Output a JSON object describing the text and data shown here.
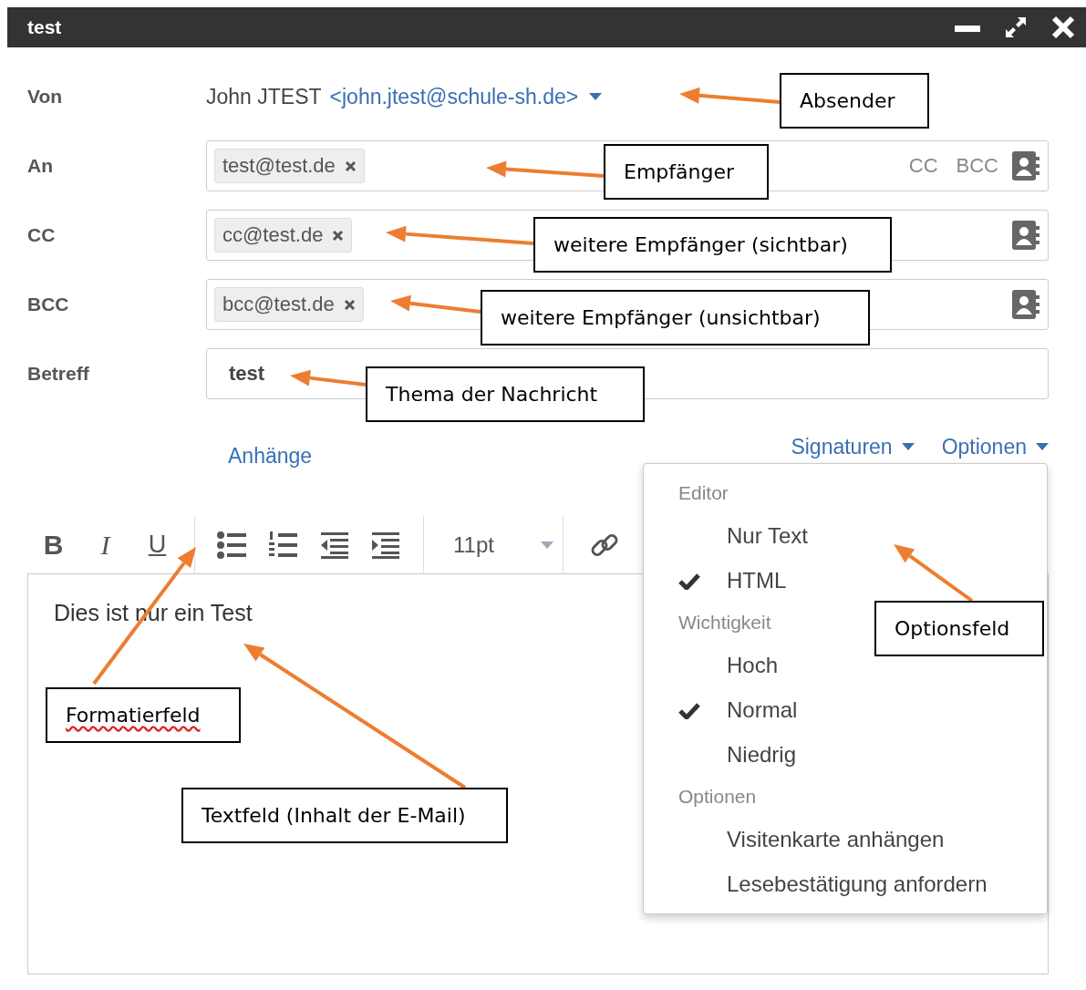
{
  "window": {
    "title": "test"
  },
  "from": {
    "label": "Von",
    "name": "John JTEST",
    "address": "<john.jtest@schule-sh.de>"
  },
  "recipient_fields": [
    {
      "label": "An",
      "chips": [
        "test@test.de"
      ],
      "links": [
        "CC",
        "BCC"
      ]
    },
    {
      "label": "CC",
      "chips": [
        "cc@test.de"
      ]
    },
    {
      "label": "BCC",
      "chips": [
        "bcc@test.de"
      ]
    }
  ],
  "subject": {
    "label": "Betreff",
    "value": "test"
  },
  "attachments_link": "Anhänge",
  "menus": [
    "Signaturen",
    "Optionen"
  ],
  "toolbar": {
    "format_buttons": [
      {
        "kind": "bold",
        "label": "B"
      },
      {
        "kind": "italic",
        "label": "I"
      },
      {
        "kind": "underline",
        "label": "U"
      }
    ],
    "font_size": "11pt"
  },
  "body": "Dies ist nur ein Test",
  "options_menu": [
    {
      "kind": "header",
      "label": "Editor"
    },
    {
      "kind": "item",
      "label": "Nur Text",
      "checked": false
    },
    {
      "kind": "item",
      "label": "HTML",
      "checked": true
    },
    {
      "kind": "header",
      "label": "Wichtigkeit"
    },
    {
      "kind": "item",
      "label": "Hoch",
      "checked": false
    },
    {
      "kind": "item",
      "label": "Normal",
      "checked": true
    },
    {
      "kind": "item",
      "label": "Niedrig",
      "checked": false
    },
    {
      "kind": "header",
      "label": "Optionen"
    },
    {
      "kind": "item",
      "label": "Visitenkarte anhängen",
      "checked": false
    },
    {
      "kind": "item",
      "label": "Lesebestätigung anfordern",
      "checked": false
    }
  ],
  "annotations": [
    {
      "text": "Absender",
      "spellcheck_flag": false
    },
    {
      "text": "Empfänger",
      "spellcheck_flag": false
    },
    {
      "text": "weitere Empfänger (sichtbar)",
      "spellcheck_flag": false
    },
    {
      "text": "weitere Empfänger (unsichtbar)",
      "spellcheck_flag": false
    },
    {
      "text": "Thema der Nachricht",
      "spellcheck_flag": false
    },
    {
      "text": "Optionsfeld",
      "spellcheck_flag": false
    },
    {
      "text": "Formatierfeld",
      "spellcheck_flag": true
    },
    {
      "text": "Textfeld (Inhalt der E-Mail)",
      "spellcheck_flag": false
    }
  ]
}
